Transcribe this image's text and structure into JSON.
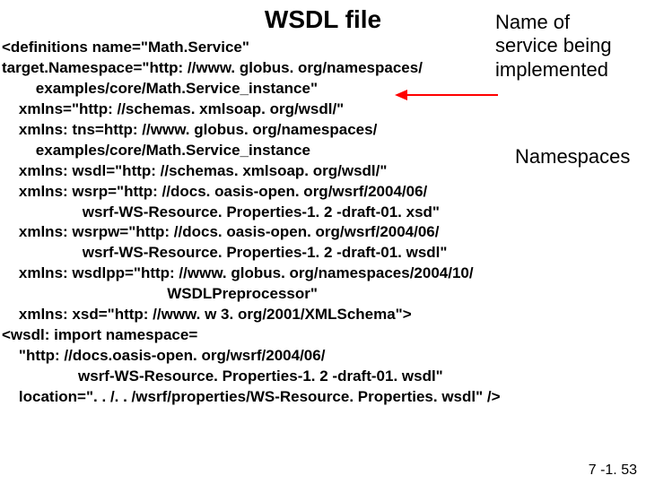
{
  "title": "WSDL file",
  "annotations": {
    "name_of_service": "Name of service being implemented",
    "namespaces": "Namespaces"
  },
  "code": "<definitions name=\"Math.Service\"\ntarget.Namespace=\"http: //www. globus. org/namespaces/\n        examples/core/Math.Service_instance\"\n    xmlns=\"http: //schemas. xmlsoap. org/wsdl/\"\n    xmlns: tns=http: //www. globus. org/namespaces/\n        examples/core/Math.Service_instance\n    xmlns: wsdl=\"http: //schemas. xmlsoap. org/wsdl/\"\n    xmlns: wsrp=\"http: //docs. oasis-open. org/wsrf/2004/06/\n                   wsrf-WS-Resource. Properties-1. 2 -draft-01. xsd\"\n    xmlns: wsrpw=\"http: //docs. oasis-open. org/wsrf/2004/06/\n                   wsrf-WS-Resource. Properties-1. 2 -draft-01. wsdl\"\n    xmlns: wsdlpp=\"http: //www. globus. org/namespaces/2004/10/\n                                       WSDLPreprocessor\"\n    xmlns: xsd=\"http: //www. w 3. org/2001/XMLSchema\">\n<wsdl: import namespace=\n    \"http: //docs.oasis-open. org/wsrf/2004/06/\n                  wsrf-WS-Resource. Properties-1. 2 -draft-01. wsdl\"\n    location=\". . /. . /wsrf/properties/WS-Resource. Properties. wsdl\" />",
  "footer": "7 -1. 53"
}
